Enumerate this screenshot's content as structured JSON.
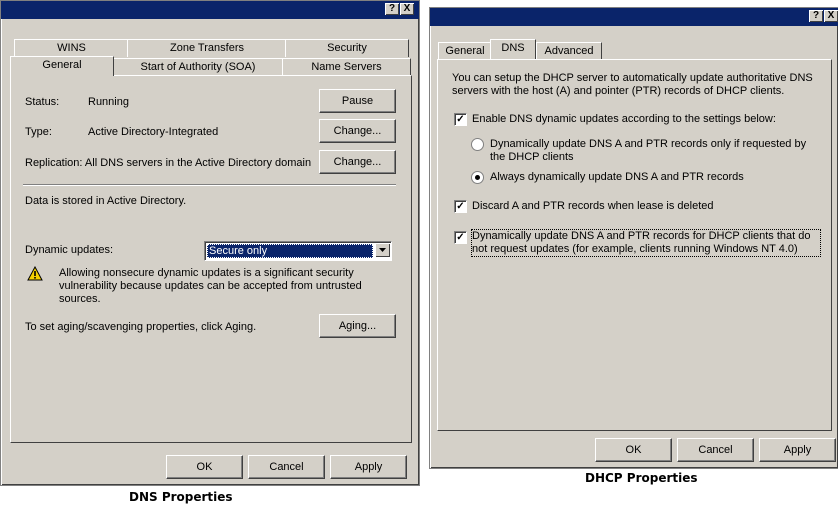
{
  "dns_dialog": {
    "title_buttons": {
      "help": "?",
      "close": "X"
    },
    "tabs_row1": [
      "WINS",
      "Zone Transfers",
      "Security"
    ],
    "tabs_row2": [
      "General",
      "Start of Authority (SOA)",
      "Name Servers"
    ],
    "status_label": "Status:",
    "status_value": "Running",
    "pause_button": "Pause",
    "type_label": "Type:",
    "type_value": "Active Directory-Integrated",
    "change_button": "Change...",
    "replication_text": "Replication: All DNS servers in the Active Directory domain",
    "change_button2": "Change...",
    "stored_text": "Data is stored in Active Directory.",
    "dynamic_updates_label": "Dynamic updates:",
    "dynamic_updates_value": "Secure only",
    "warning_text": "Allowing nonsecure dynamic updates is a significant security vulnerability because updates can be accepted from untrusted sources.",
    "aging_text": "To set aging/scavenging properties, click Aging.",
    "aging_button": "Aging...",
    "ok_button": "OK",
    "cancel_button": "Cancel",
    "apply_button": "Apply",
    "caption": "DNS Properties"
  },
  "dhcp_dialog": {
    "title_buttons": {
      "help": "?",
      "close": "X"
    },
    "tabs": [
      "General",
      "DNS",
      "Advanced"
    ],
    "intro_text": "You can setup the DHCP server to automatically update authoritative DNS servers with the host (A) and pointer (PTR) records of DHCP clients.",
    "enable_checkbox": {
      "label": "Enable DNS dynamic updates according to the settings below:",
      "checked": true
    },
    "radio_requested": {
      "label": "Dynamically update DNS A and PTR records only if requested by the DHCP clients",
      "selected": false
    },
    "radio_always": {
      "label": "Always dynamically update DNS A and PTR records",
      "selected": true
    },
    "discard_checkbox": {
      "label": "Discard A and PTR records when lease is deleted",
      "checked": true
    },
    "nonrequest_checkbox": {
      "label": "Dynamically update DNS A and PTR records for DHCP clients that do not request updates (for example, clients running Windows NT 4.0)",
      "checked": true
    },
    "ok_button": "OK",
    "cancel_button": "Cancel",
    "apply_button": "Apply",
    "caption": "DHCP Properties"
  },
  "colors": {
    "titlebar": "#0a246a",
    "dialog_face": "#d4d0c8",
    "selection": "#0a246a",
    "warning_icon": "#f5d000"
  }
}
